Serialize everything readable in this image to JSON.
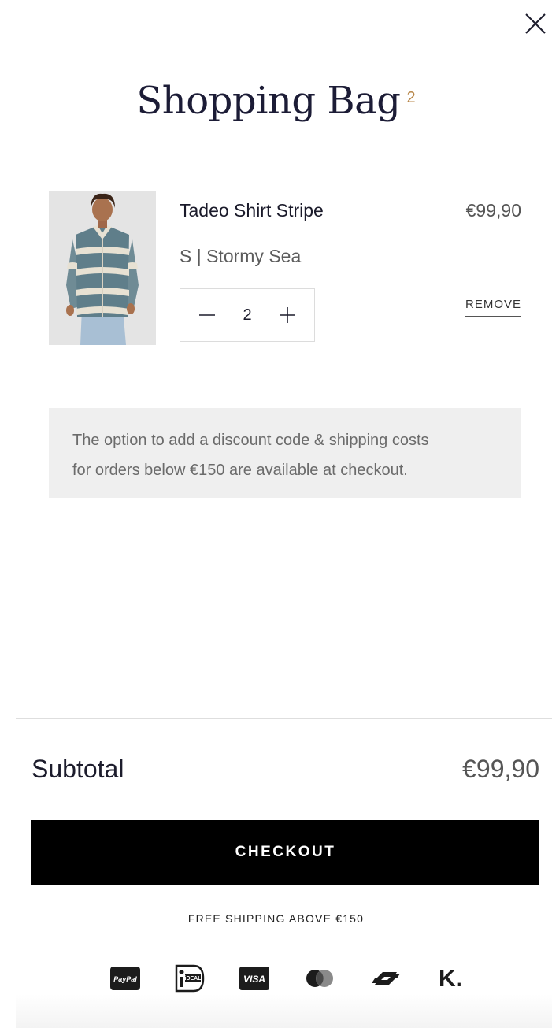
{
  "header": {
    "title": "Shopping Bag",
    "count": "2"
  },
  "cart": {
    "items": [
      {
        "name": "Tadeo Shirt Stripe",
        "price": "€99,90",
        "variant": "S | Stormy Sea",
        "quantity": "2",
        "remove_label": "REMOVE"
      }
    ]
  },
  "notice": {
    "line1": "The option to add a discount code & shipping costs",
    "line2": "for orders below €150 are available at checkout."
  },
  "summary": {
    "subtotal_label": "Subtotal",
    "subtotal_value": "€99,90",
    "checkout_label": "CHECKOUT",
    "free_shipping": "FREE SHIPPING ABOVE €150"
  },
  "payment_methods": [
    {
      "icon": "paypal-icon",
      "label": "PayPal"
    },
    {
      "icon": "ideal-icon",
      "label": "iDEAL"
    },
    {
      "icon": "visa-icon",
      "label": "VISA"
    },
    {
      "icon": "mastercard-icon"
    },
    {
      "icon": "bancontact-icon"
    },
    {
      "icon": "klarna-icon",
      "label": "K."
    }
  ],
  "colors": {
    "accent": "#b8874a",
    "checkout_bg": "#000000",
    "notice_bg": "#efefef"
  }
}
